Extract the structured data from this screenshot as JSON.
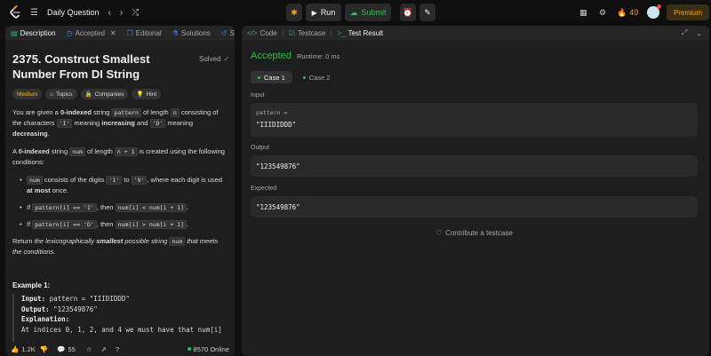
{
  "topbar": {
    "title": "Daily Question",
    "run_label": "Run",
    "submit_label": "Submit",
    "streak_count": "49",
    "premium_label": "Premium"
  },
  "left_tabs": [
    {
      "label": "Description"
    },
    {
      "label": "Accepted"
    },
    {
      "label": "Editorial"
    },
    {
      "label": "Solutions"
    },
    {
      "label": "Su"
    }
  ],
  "problem": {
    "title": "2375. Construct Smallest Number From DI String",
    "status": "Solved",
    "difficulty": "Medium",
    "topics": "Topics",
    "companies": "Companies",
    "hint": "Hint"
  },
  "description": {
    "p1_a": "You are given a ",
    "p1_b": "0-indexed",
    "p1_c": " string ",
    "p1_code1": "pattern",
    "p1_d": " of length ",
    "p1_code2": "n",
    "p1_e": " consisting of the characters ",
    "p1_code3": "'I'",
    "p1_f": " meaning ",
    "p1_g": "increasing",
    "p1_h": " and ",
    "p1_code4": "'D'",
    "p1_i": " meaning ",
    "p1_j": "decreasing",
    "p1_k": ".",
    "p2_a": "A ",
    "p2_b": "0-indexed",
    "p2_c": " string ",
    "p2_code1": "num",
    "p2_d": " of length ",
    "p2_code2": "n + 1",
    "p2_e": " is created using the following conditions:",
    "li1_code1": "num",
    "li1_a": " consists of the digits ",
    "li1_code2": "'1'",
    "li1_b": " to ",
    "li1_code3": "'9'",
    "li1_c": ", where each digit is used ",
    "li1_d": "at most",
    "li1_e": " once.",
    "li2_a": "If ",
    "li2_code1": "pattern[i] == 'I'",
    "li2_b": ", then ",
    "li2_code2": "num[i] < num[i + 1]",
    "li2_c": ".",
    "li3_a": "If ",
    "li3_code1": "pattern[i] == 'D'",
    "li3_b": ", then ",
    "li3_code2": "num[i] > num[i + 1]",
    "li3_c": ".",
    "p3_a": "Return ",
    "p3_b": "the lexicographically ",
    "p3_c": "smallest",
    "p3_d": " possible string ",
    "p3_code": "num",
    "p3_e": " that meets the conditions."
  },
  "example": {
    "title": "Example 1:",
    "input_label": "Input:",
    "input_value": " pattern = \"IIIDIDDD\"",
    "output_label": "Output:",
    "output_value": " \"123549876\"",
    "explanation_label": "Explanation:",
    "explanation_line": "At indices 0, 1, 2, and 4 we must have that num[i]"
  },
  "bottom": {
    "likes": "1.2K",
    "comments": "55",
    "online": "8570 Online"
  },
  "right_tabs": [
    {
      "label": "Code"
    },
    {
      "label": "Testcase"
    },
    {
      "label": "Test Result"
    }
  ],
  "result": {
    "status": "Accepted",
    "runtime": "Runtime: 0 ms",
    "case1": "Case 1",
    "case2": "Case 2",
    "input_label": "Input",
    "param_name": "pattern =",
    "param_value": "\"IIIDIDDD\"",
    "output_label": "Output",
    "output_value": "\"123549876\"",
    "expected_label": "Expected",
    "expected_value": "\"123549876\"",
    "contribute": "Contribute a testcase"
  },
  "colors": {
    "accent_green": "#28c244",
    "accent_orange": "#ffa116",
    "medium_yellow": "#ffb800"
  }
}
